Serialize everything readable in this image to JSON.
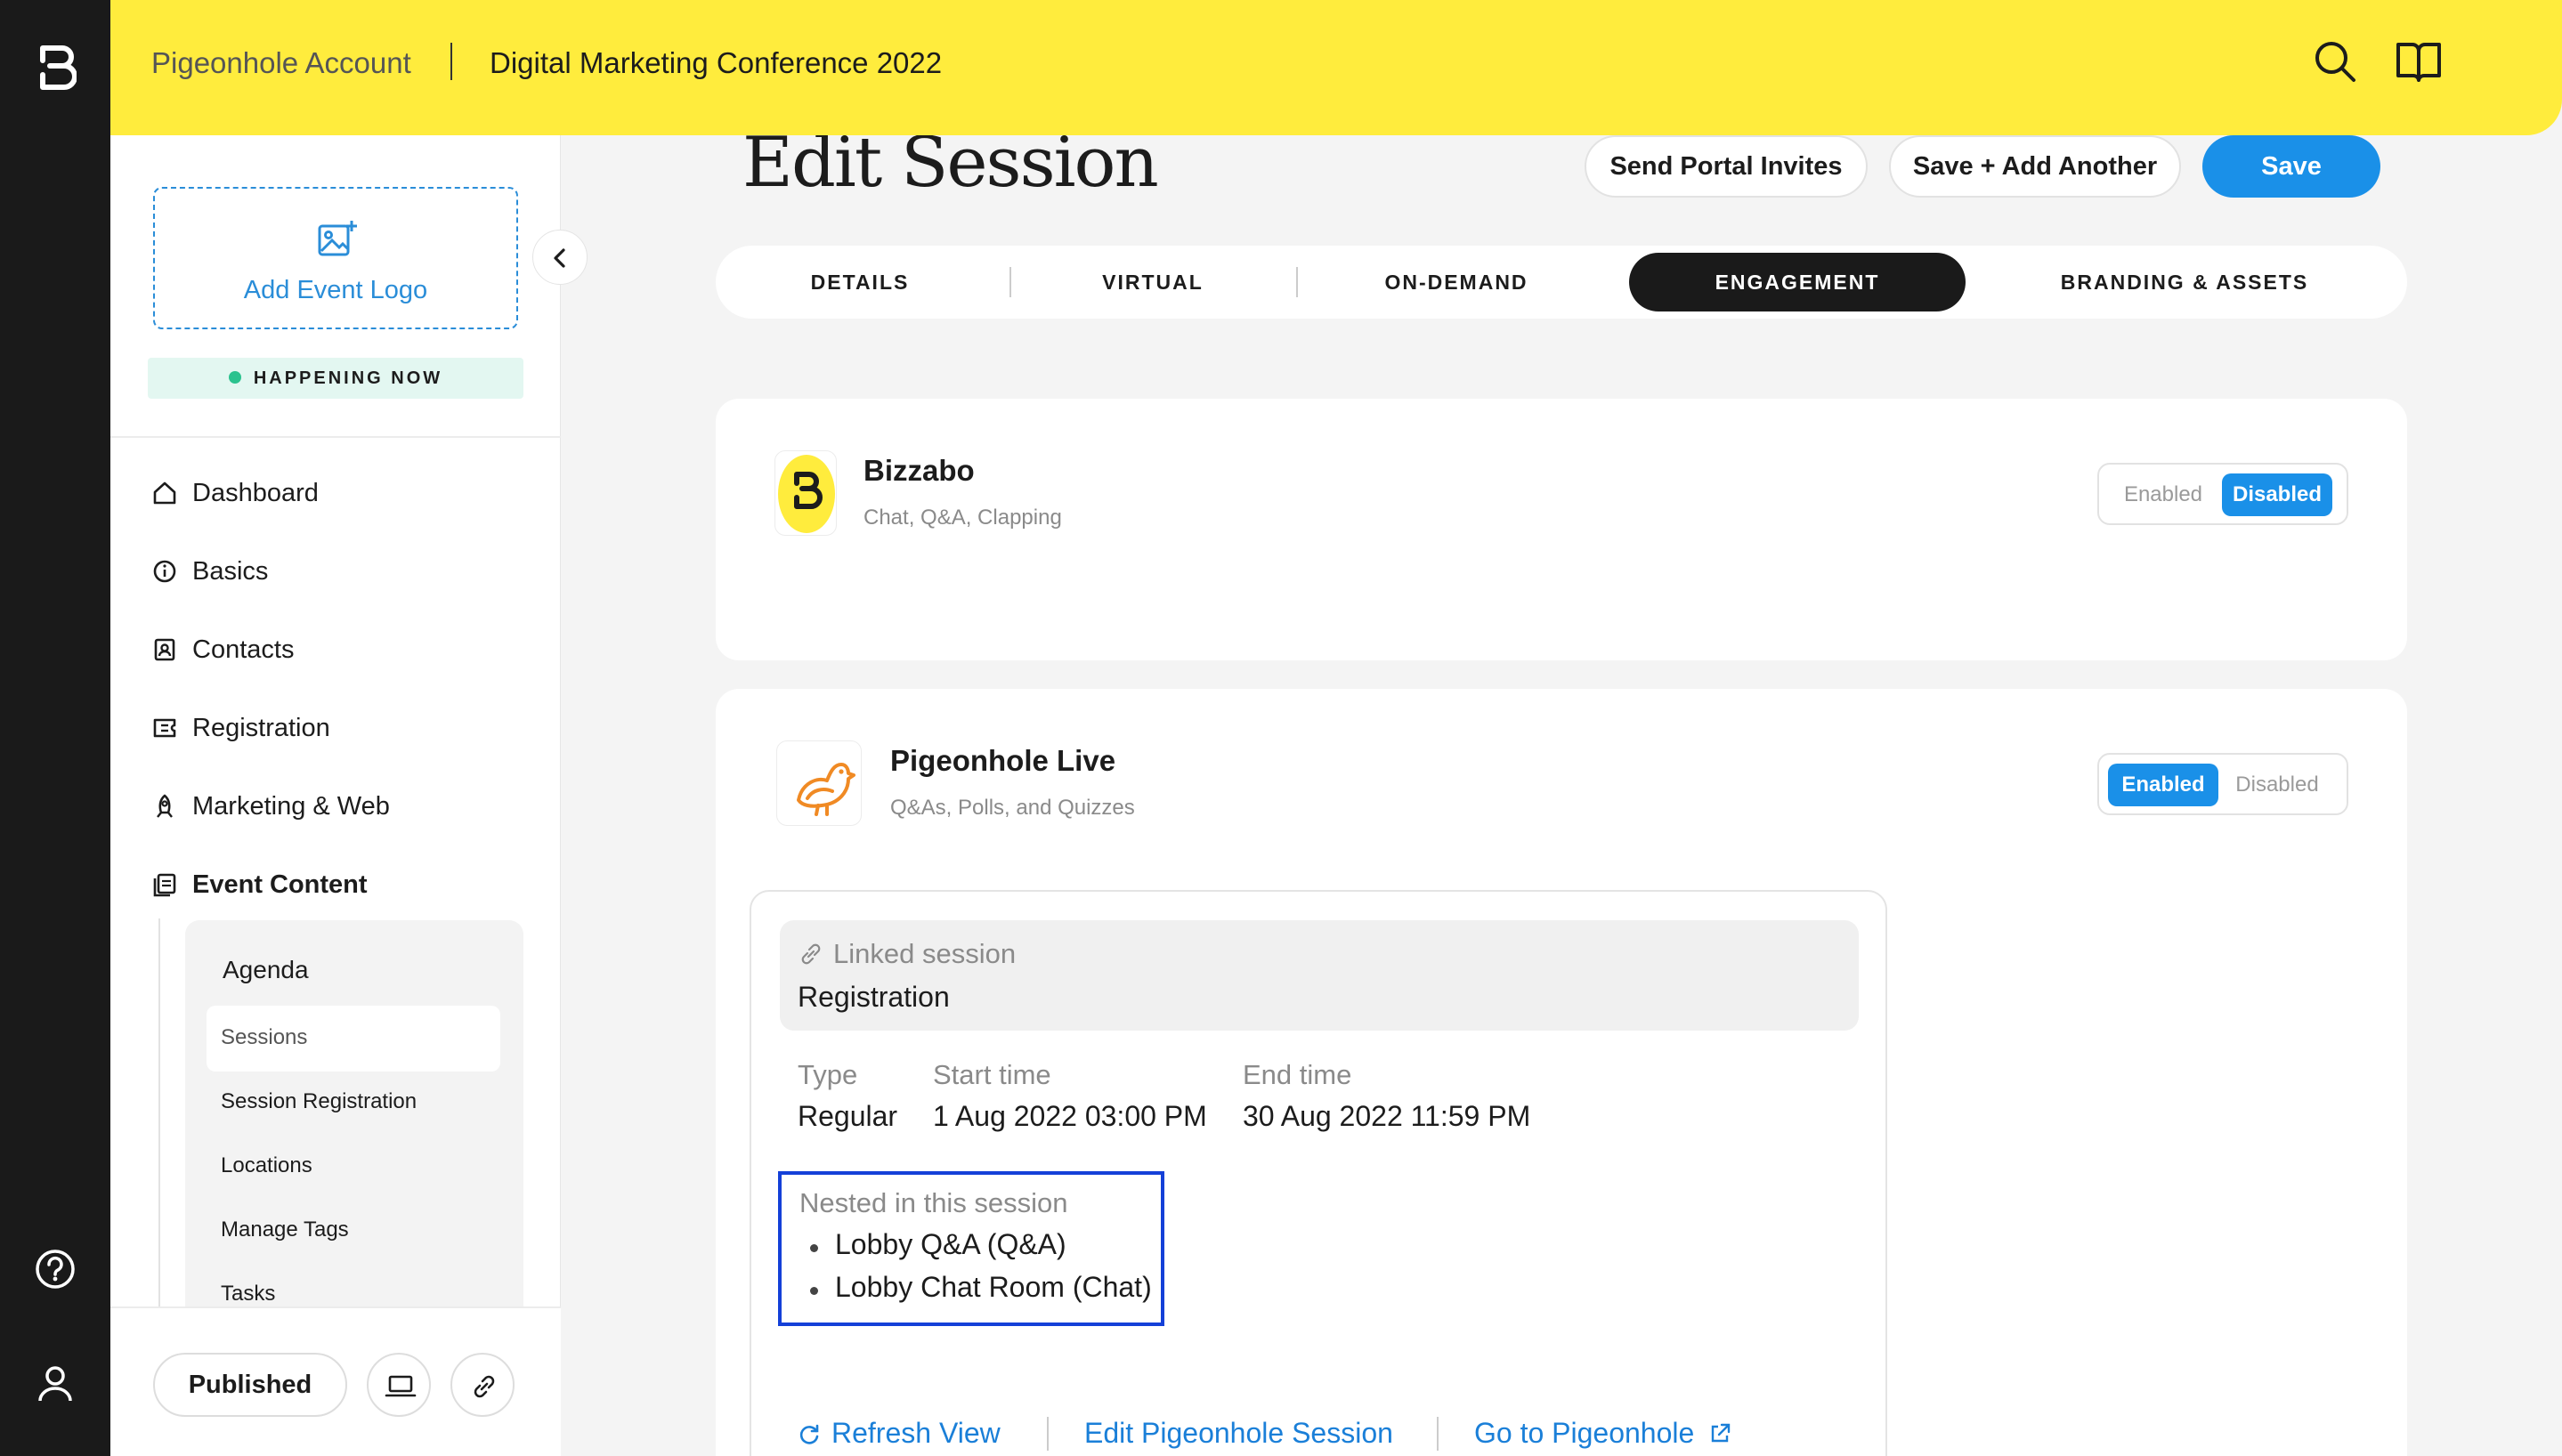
{
  "topbar": {
    "account": "Pigeonhole Account",
    "event": "Digital Marketing Conference 2022"
  },
  "sidebar": {
    "add_logo": "Add Event Logo",
    "status": "HAPPENING NOW",
    "nav": [
      {
        "label": "Dashboard",
        "icon": "home-icon"
      },
      {
        "label": "Basics",
        "icon": "info-icon"
      },
      {
        "label": "Contacts",
        "icon": "contacts-icon"
      },
      {
        "label": "Registration",
        "icon": "ticket-icon"
      },
      {
        "label": "Marketing & Web",
        "icon": "rocket-icon"
      },
      {
        "label": "Event Content",
        "icon": "content-icon"
      }
    ],
    "submenu": {
      "title": "Agenda",
      "items": [
        "Sessions",
        "Session Registration",
        "Locations",
        "Manage Tags",
        "Tasks"
      ]
    },
    "published": "Published"
  },
  "main": {
    "title": "Edit Session",
    "buttons": {
      "send_invites": "Send Portal Invites",
      "save_add": "Save + Add Another",
      "save": "Save"
    },
    "tabs": [
      "DETAILS",
      "VIRTUAL",
      "ON-DEMAND",
      "ENGAGEMENT",
      "BRANDING & ASSETS"
    ],
    "active_tab": "ENGAGEMENT",
    "providers": [
      {
        "name": "Bizzabo",
        "desc": "Chat, Q&A, Clapping",
        "enabled_label": "Enabled",
        "disabled_label": "Disabled",
        "state": "Disabled"
      },
      {
        "name": "Pigeonhole Live",
        "desc": "Q&As, Polls, and Quizzes",
        "enabled_label": "Enabled",
        "disabled_label": "Disabled",
        "state": "Enabled"
      }
    ],
    "linked": {
      "label": "Linked session",
      "value": "Registration",
      "type_label": "Type",
      "type_value": "Regular",
      "start_label": "Start time",
      "start_value": "1 Aug 2022 03:00 PM",
      "end_label": "End time",
      "end_value": "30 Aug 2022 11:59 PM",
      "nested_title": "Nested in this session",
      "nested_items": [
        "Lobby Q&A (Q&A)",
        "Lobby Chat Room (Chat)"
      ]
    },
    "links": {
      "refresh": "Refresh View",
      "edit": "Edit Pigeonhole Session",
      "go": "Go to Pigeonhole"
    }
  },
  "colors": {
    "topbar": "#ffec3d",
    "primary": "#1a90e8",
    "rail": "#1a1a1a",
    "highlight": "#1440d8"
  }
}
